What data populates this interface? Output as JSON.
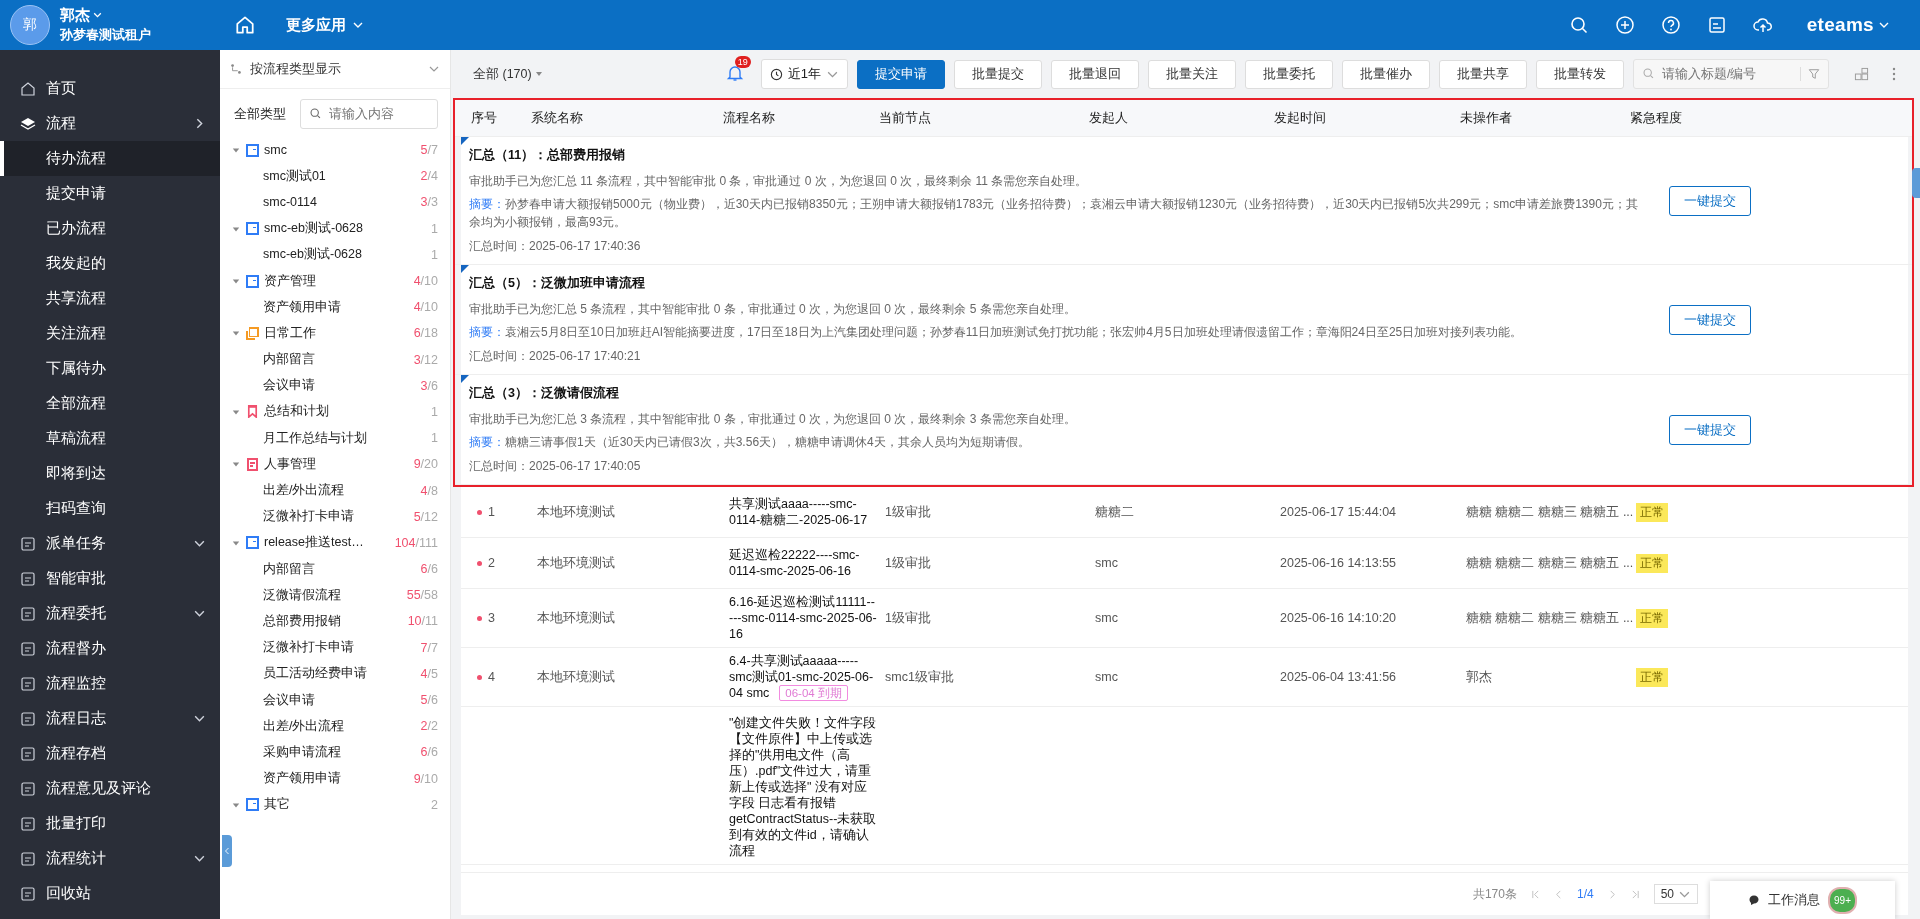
{
  "user": {
    "avatar": "郭",
    "name": "郭杰",
    "tenant": "孙梦春测试租户"
  },
  "top_nav": {
    "more_apps": "更多应用",
    "brand": "eteams"
  },
  "nav": [
    {
      "label": "首页",
      "kind": "plain",
      "selected": false
    },
    {
      "label": "流程",
      "kind": "flyout",
      "selected": false,
      "children": [
        {
          "label": "待办流程",
          "selected": true
        },
        {
          "label": "提交申请",
          "selected": false
        },
        {
          "label": "已办流程",
          "selected": false
        },
        {
          "label": "我发起的",
          "selected": false
        },
        {
          "label": "共享流程",
          "selected": false
        },
        {
          "label": "关注流程",
          "selected": false
        },
        {
          "label": "下属待办",
          "selected": false
        },
        {
          "label": "全部流程",
          "selected": false
        },
        {
          "label": "草稿流程",
          "selected": false
        },
        {
          "label": "即将到达",
          "selected": false
        },
        {
          "label": "扫码查询",
          "selected": false
        }
      ]
    },
    {
      "label": "派单任务",
      "kind": "dropdown",
      "selected": false
    },
    {
      "label": "智能审批",
      "kind": "plain",
      "selected": false
    },
    {
      "label": "流程委托",
      "kind": "dropdown",
      "selected": false
    },
    {
      "label": "流程督办",
      "kind": "plain",
      "selected": false
    },
    {
      "label": "流程监控",
      "kind": "plain",
      "selected": false
    },
    {
      "label": "流程日志",
      "kind": "dropdown",
      "selected": false
    },
    {
      "label": "流程存档",
      "kind": "plain",
      "selected": false
    },
    {
      "label": "流程意见及评论",
      "kind": "plain",
      "selected": false
    },
    {
      "label": "批量打印",
      "kind": "plain",
      "selected": false
    },
    {
      "label": "流程统计",
      "kind": "dropdown",
      "selected": false
    },
    {
      "label": "回收站",
      "kind": "plain",
      "selected": false
    }
  ],
  "type_panel": {
    "view_select": "按流程类型显示",
    "filter_label": "全部类型",
    "search": {
      "placeholder": "请输入内容"
    },
    "tree": [
      {
        "name": "smc",
        "kind": "form",
        "color": "#2f7cf6",
        "done": "5",
        "of_total": "/7",
        "expanded": true,
        "children": [
          {
            "name": "smc测试01",
            "done": "2",
            "of_total": "/4"
          },
          {
            "name": "smc-0114",
            "done": "3",
            "of_total": "/3"
          }
        ]
      },
      {
        "name": "smc-eb测试-0628",
        "kind": "form",
        "color": "#2f7cf6",
        "of_total": "1",
        "expanded": true,
        "children": [
          {
            "name": "smc-eb测试-0628",
            "of_total": "1"
          }
        ]
      },
      {
        "name": "资产管理",
        "kind": "form",
        "color": "#2f7cf6",
        "done": "4",
        "of_total": "/10",
        "expanded": true,
        "children": [
          {
            "name": "资产领用申请",
            "done": "4",
            "of_total": "/10"
          }
        ]
      },
      {
        "name": "日常工作",
        "kind": "stack",
        "color": "#f59a23",
        "done": "6",
        "of_total": "/18",
        "expanded": true,
        "children": [
          {
            "name": "内部留言",
            "done": "3",
            "of_total": "/12"
          },
          {
            "name": "会议申请",
            "done": "3",
            "of_total": "/6"
          }
        ]
      },
      {
        "name": "总结和计划",
        "kind": "bookmark",
        "color": "#f0506e",
        "of_total": "1",
        "expanded": true,
        "children": [
          {
            "name": "月工作总结与计划",
            "of_total": "1"
          }
        ]
      },
      {
        "name": "人事管理",
        "kind": "receipt",
        "color": "#f0506e",
        "done": "9",
        "of_total": "/20",
        "expanded": true,
        "children": [
          {
            "name": "出差/外出流程",
            "done": "4",
            "of_total": "/8"
          },
          {
            "name": "泛微补打卡申请",
            "done": "5",
            "of_total": "/12"
          }
        ]
      },
      {
        "name": "release推送test…",
        "kind": "form",
        "color": "#2f7cf6",
        "done": "104",
        "of_total": "/111",
        "expanded": true,
        "children": [
          {
            "name": "内部留言",
            "done": "6",
            "of_total": "/6"
          },
          {
            "name": "泛微请假流程",
            "done": "55",
            "of_total": "/58"
          },
          {
            "name": "总部费用报销",
            "done": "10",
            "of_total": "/11"
          },
          {
            "name": "泛微补打卡申请",
            "done": "7",
            "of_total": "/7"
          },
          {
            "name": "员工活动经费申请",
            "done": "4",
            "of_total": "/5"
          },
          {
            "name": "会议申请",
            "done": "5",
            "of_total": "/6"
          },
          {
            "name": "出差/外出流程",
            "done": "2",
            "of_total": "/2"
          },
          {
            "name": "采购申请流程",
            "done": "6",
            "of_total": "/6"
          },
          {
            "name": "资产领用申请",
            "done": "9",
            "of_total": "/10"
          }
        ]
      },
      {
        "name": "其它",
        "kind": "form",
        "color": "#2f7cf6",
        "of_total": "2",
        "expanded": true
      }
    ]
  },
  "toolbar": {
    "scope": "全部 (170)",
    "bell_badge": "19",
    "period": "近1年",
    "buttons": [
      {
        "label": "提交申请",
        "kind": "primary"
      },
      {
        "label": "批量提交",
        "kind": "default"
      },
      {
        "label": "批量退回",
        "kind": "default"
      },
      {
        "label": "批量关注",
        "kind": "default"
      },
      {
        "label": "批量委托",
        "kind": "default"
      },
      {
        "label": "批量催办",
        "kind": "default"
      },
      {
        "label": "批量共享",
        "kind": "default"
      },
      {
        "label": "批量转发",
        "kind": "default"
      }
    ],
    "search": {
      "placeholder": "请输入标题/编号"
    }
  },
  "table": {
    "columns": [
      "序号",
      "系统名称",
      "流程名称",
      "当前节点",
      "发起人",
      "发起时间",
      "未操作者",
      "紧急程度"
    ],
    "summaries": [
      {
        "title": "汇总（11）：总部费用报销",
        "body": "审批助手已为您汇总 11 条流程，其中智能审批 0 条，审批通过 0 次，为您退回 0 次，最终剩余 11 条需您亲自处理。",
        "summary_label": "摘要：",
        "summary": "孙梦春申请大额报销5000元（物业费），近30天内已报销8350元；王朔申请大额报销1783元（业务招待费）；袁湘云申请大额报销1230元（业务招待费），近30天内已报销5次共299元；smc申请差旅费1390元；其余均为小额报销，最高93元。",
        "time": "汇总时间：2025-06-17 17:40:36",
        "button": "一键提交"
      },
      {
        "title": "汇总（5）：泛微加班申请流程",
        "body": "审批助手已为您汇总 5 条流程，其中智能审批 0 条，审批通过 0 次，为您退回 0 次，最终剩余 5 条需您亲自处理。",
        "summary_label": "摘要：",
        "summary": "袁湘云5月8日至10日加班赶AI智能摘要进度，17日至18日为上汽集团处理问题；孙梦春11日加班测试免打扰功能；张宏帅4月5日加班处理请假遗留工作；章海阳24日至25日加班对接列表功能。",
        "time": "汇总时间：2025-06-17 17:40:21",
        "button": "一键提交"
      },
      {
        "title": "汇总（3）：泛微请假流程",
        "body": "审批助手已为您汇总 3 条流程，其中智能审批 0 条，审批通过 0 次，为您退回 0 次，最终剩余 3 条需您亲自处理。",
        "summary_label": "摘要：",
        "summary": "糖糖三请事假1天（近30天内已请假3次，共3.56天），糖糖申请调休4天，其余人员均为短期请假。",
        "time": "汇总时间：2025-06-17 17:40:05",
        "button": "一键提交"
      }
    ],
    "rows": [
      {
        "no": "1",
        "system": "本地环境测试",
        "title": "共享测试aaaa-----smc-0114-糖糖二-2025-06-17",
        "node": "1级审批",
        "initiator": "糖糖二",
        "time": "2025-06-17 15:44:04",
        "pending": "糖糖 糖糖二 糖糖三 糖糖五 ...",
        "urgency": "正常"
      },
      {
        "no": "2",
        "system": "本地环境测试",
        "title": "延迟巡检22222----smc-0114-smc-2025-06-16",
        "node": "1级审批",
        "initiator": "smc",
        "time": "2025-06-16 14:13:55",
        "pending": "糖糖 糖糖二 糖糖三 糖糖五 ...",
        "urgency": "正常"
      },
      {
        "no": "3",
        "system": "本地环境测试",
        "title": "6.16-延迟巡检测试11111-----smc-0114-smc-2025-06-16",
        "node": "1级审批",
        "initiator": "smc",
        "time": "2025-06-16 14:10:20",
        "pending": "糖糖 糖糖二 糖糖三 糖糖五 ...",
        "urgency": "正常"
      },
      {
        "no": "4",
        "system": "本地环境测试",
        "title": "6.4-共享测试aaaaa-----smc测试01-smc-2025-06-04  smc",
        "tag": "06-04 到期",
        "node": "smc1级审批",
        "initiator": "smc",
        "time": "2025-06-04 13:41:56",
        "pending": "郭杰",
        "urgency": "正常"
      },
      {
        "title": "\"创建文件失败！文件字段【文件原件】中上传或选择的\"供用电文件（高压）.pdf\"文件过大，请重新上传或选择\" 没有对应字段 日志看有报错 getContractStatus--未获取到有效的文件id，请确认流程"
      }
    ]
  },
  "pagination": {
    "total": "共170条",
    "page": "1/4",
    "page_size": "50"
  },
  "work_message": {
    "label": "工作消息",
    "badge": "99+"
  }
}
